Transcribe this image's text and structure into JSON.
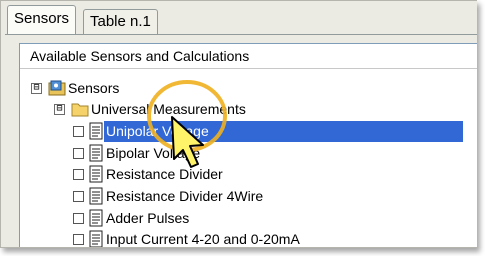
{
  "tabs": [
    {
      "label": "Sensors",
      "active": true
    },
    {
      "label": "Table n.1",
      "active": false
    }
  ],
  "panel": {
    "title": "Available Sensors and Calculations"
  },
  "tree": {
    "root": {
      "label": "Sensors",
      "expander": "⊟"
    },
    "group": {
      "label": "Universal Measurements",
      "expander": "⊟"
    },
    "items": [
      {
        "label": "Unipolar Voltage",
        "selected": true
      },
      {
        "label": "Bipolar Voltage",
        "selected": false
      },
      {
        "label": "Resistance Divider",
        "selected": false
      },
      {
        "label": "Resistance Divider 4Wire",
        "selected": false
      },
      {
        "label": "Adder Pulses",
        "selected": false
      },
      {
        "label": "Input Current 4-20 and 0-20mA",
        "selected": false
      }
    ]
  },
  "colors": {
    "selection": "#3168d5",
    "highlight_circle": "#f0b020"
  }
}
